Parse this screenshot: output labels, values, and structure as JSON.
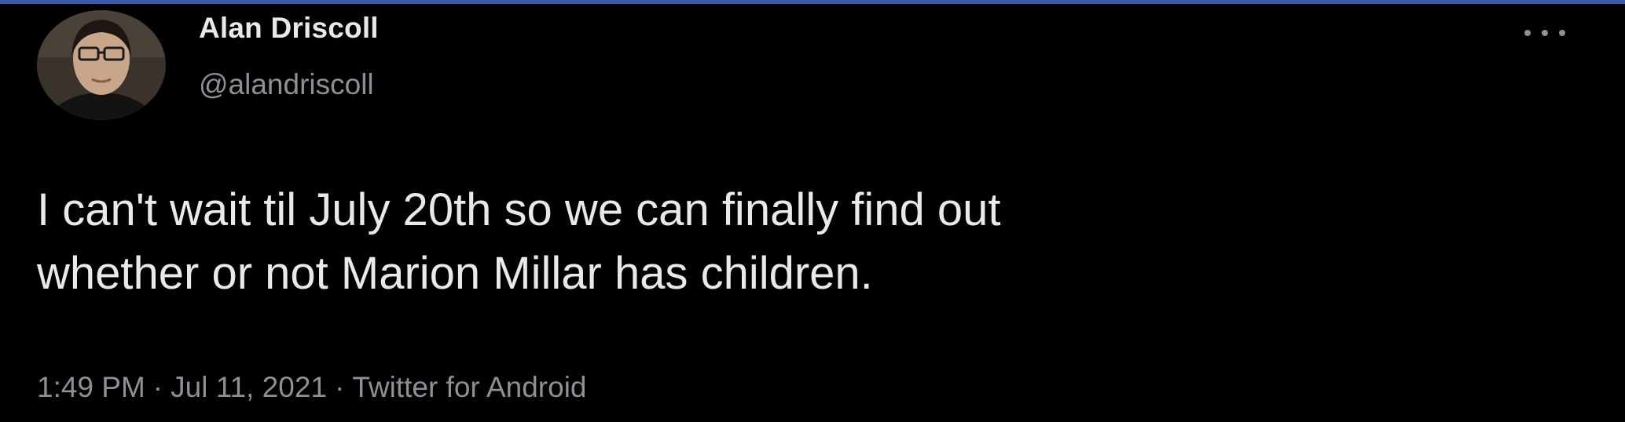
{
  "tweet": {
    "author": {
      "display_name": "Alan Driscoll",
      "handle": "@alandriscoll",
      "avatar": "profile-photo"
    },
    "text_lines": [
      "I can't wait til July 20th so we can finally find out",
      "whether or not Marion Millar has children."
    ],
    "time": "1:49 PM",
    "separator": "·",
    "date": "Jul 11, 2021",
    "source": "Twitter for Android",
    "more_icon": "more-horizontal-icon"
  },
  "colors": {
    "background": "#000000",
    "primary_text": "#e7e9ea",
    "secondary_text": "#8b9196",
    "top_border": "#3b5aa8"
  }
}
